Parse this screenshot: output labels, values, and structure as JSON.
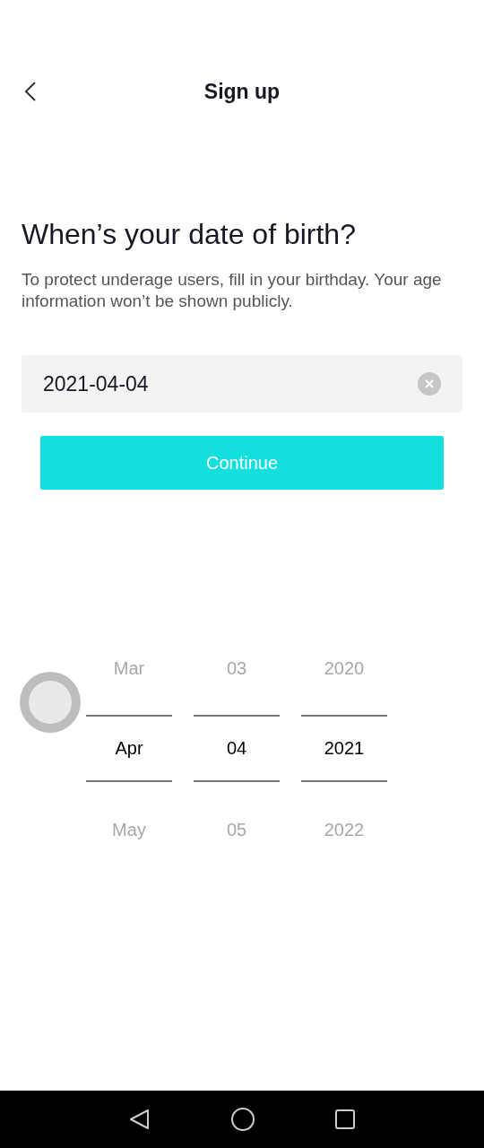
{
  "header": {
    "title": "Sign up"
  },
  "heading": "When’s your date of birth?",
  "description": "To protect underage users, fill in your birthday. Your age information won’t be shown publicly.",
  "date_field": {
    "value": "2021-04-04"
  },
  "continue_button": {
    "label": "Continue"
  },
  "picker": {
    "columns": [
      {
        "items": [
          {
            "label": "Mar",
            "selected": false
          },
          {
            "label": "Apr",
            "selected": true
          },
          {
            "label": "May",
            "selected": false
          }
        ]
      },
      {
        "items": [
          {
            "label": "03",
            "selected": false
          },
          {
            "label": "04",
            "selected": true
          },
          {
            "label": "05",
            "selected": false
          }
        ]
      },
      {
        "items": [
          {
            "label": "2020",
            "selected": false
          },
          {
            "label": "2021",
            "selected": true
          },
          {
            "label": "2022",
            "selected": false
          }
        ]
      }
    ]
  }
}
